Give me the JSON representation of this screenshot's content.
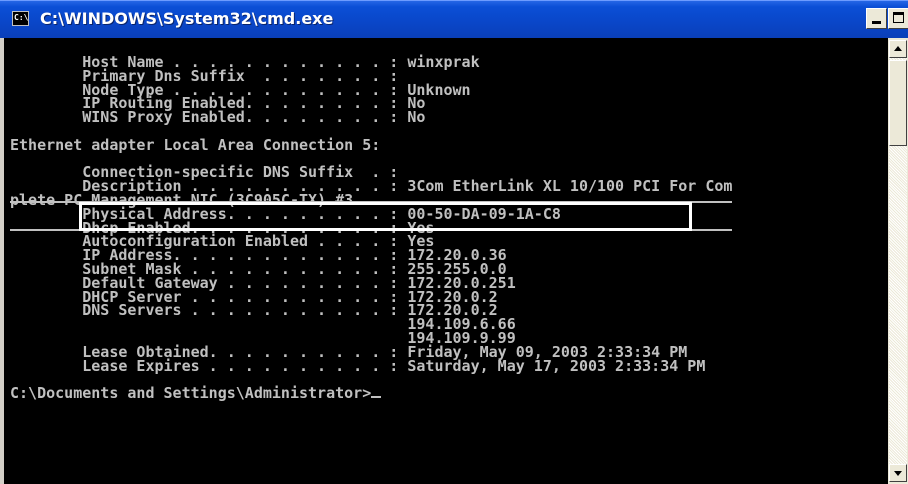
{
  "window": {
    "title": "C:\\WINDOWS\\System32\\cmd.exe",
    "icon": "cmd-icon",
    "icon_label": "C:\\",
    "controls": {
      "minimize": "minimize-icon",
      "maximize": "maximize-icon",
      "close_glyph": "×"
    }
  },
  "colors": {
    "titlebar": "#0a46c8",
    "console_background": "#000000",
    "console_text": "#c0c0c0",
    "highlight_border": "#ffffff"
  },
  "console": {
    "lines": [
      "        Host Name . . . . . . . . . . . . : winxprak",
      "        Primary Dns Suffix  . . . . . . . :",
      "        Node Type . . . . . . . . . . . . : Unknown",
      "        IP Routing Enabled. . . . . . . . : No",
      "        WINS Proxy Enabled. . . . . . . . : No",
      "",
      "Ethernet adapter Local Area Connection 5:",
      "",
      "        Connection-specific DNS Suffix  . :",
      "        Description . . . . . . . . . . . : 3Com EtherLink XL 10/100 PCI For Com",
      "plete PC Management NIC (3C905C-TX) #3",
      "        Physical Address. . . . . . . . . : 00-50-DA-09-1A-C8",
      "        Dhcp Enabled. . . . . . . . . . . : Yes",
      "        Autoconfiguration Enabled . . . . : Yes",
      "        IP Address. . . . . . . . . . . . : 172.20.0.36",
      "        Subnet Mask . . . . . . . . . . . : 255.255.0.0",
      "        Default Gateway . . . . . . . . . : 172.20.0.251",
      "        DHCP Server . . . . . . . . . . . : 172.20.0.2",
      "        DNS Servers . . . . . . . . . . . : 172.20.0.2",
      "                                            194.109.6.66",
      "                                            194.109.9.99",
      "        Lease Obtained. . . . . . . . . . : Friday, May 09, 2003 2:33:34 PM",
      "        Lease Expires . . . . . . . . . . : Saturday, May 17, 2003 2:33:34 PM",
      "",
      "C:\\Documents and Settings\\Administrator>"
    ]
  },
  "highlight": {
    "label": "Physical Address",
    "value": "00-50-DA-09-1A-C8"
  },
  "scrollbar": {
    "up": "scroll-up-arrow-icon",
    "down": "scroll-down-arrow-icon"
  }
}
